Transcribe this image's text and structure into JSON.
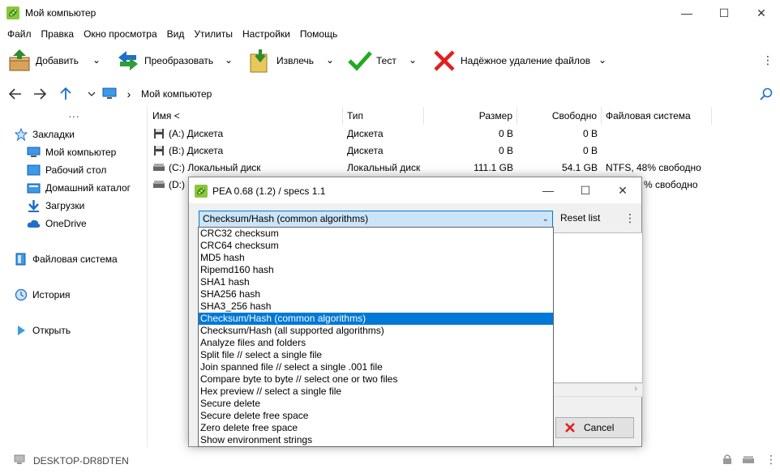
{
  "window": {
    "title": "Мой компьютер",
    "controls": {
      "minimize": "—",
      "maximize": "☐",
      "close": "✕"
    }
  },
  "menu": [
    "Файл",
    "Правка",
    "Окно просмотра",
    "Вид",
    "Утилиты",
    "Настройки",
    "Помощь"
  ],
  "toolbar": {
    "add": "Добавить",
    "convert": "Преобразовать",
    "extract": "Извлечь",
    "test": "Тест",
    "secure_delete": "Надёжное удаление файлов",
    "more": "⋮",
    "caret": "⌄"
  },
  "address": {
    "path": "Мой компьютер",
    "separator": "›"
  },
  "sidebar": {
    "dots": "···",
    "items": [
      {
        "label": "Закладки"
      },
      {
        "label": "Мой компьютер"
      },
      {
        "label": "Рабочий стол"
      },
      {
        "label": "Домашний каталог"
      },
      {
        "label": "Загрузки"
      },
      {
        "label": "OneDrive"
      },
      {
        "label": "Файловая система"
      },
      {
        "label": "История"
      },
      {
        "label": "Открыть"
      }
    ]
  },
  "list": {
    "columns": [
      "Имя <",
      "Тип",
      "Размер",
      "Свободно",
      "Файловая система"
    ],
    "rows": [
      {
        "name": "(A:) Дискета",
        "type": "Дискета",
        "size": "0 B",
        "free": "0 B",
        "fs": ""
      },
      {
        "name": "(B:) Дискета",
        "type": "Дискета",
        "size": "0 B",
        "free": "0 B",
        "fs": ""
      },
      {
        "name": "(C:) Локальный диск",
        "type": "Локальный диск",
        "size": "111.1 GB",
        "free": "54.1 GB",
        "fs": "NTFS, 48% свободно"
      },
      {
        "name": "(D:)",
        "type": "",
        "size": "",
        "free": "",
        "fs": "% свободно"
      }
    ]
  },
  "status": {
    "computer": "DESKTOP-DR8DTEN",
    "more": "⋮"
  },
  "dialog": {
    "title": "PEA 0.68 (1.2) / specs 1.1",
    "combo_value": "Checksum/Hash (common algorithms)",
    "combo_arrow": "⌄",
    "reset": "Reset list",
    "more": "⋮",
    "cancel": "Cancel",
    "scroll_left": "‹",
    "scroll_right": "›"
  },
  "dropdown": {
    "selected_index": 7,
    "options": [
      "CRC32 checksum",
      "CRC64 checksum",
      "MD5 hash",
      "Ripemd160 hash",
      "SHA1 hash",
      "SHA256 hash",
      "SHA3_256 hash",
      "Checksum/Hash (common algorithms)",
      "Checksum/Hash (all supported algorithms)",
      "Analyze files and folders",
      "Split file // select a single file",
      "Join spanned file // select a single .001 file",
      "Compare byte to byte // select one or two files",
      "Hex preview // select a single file",
      "Secure delete",
      "Secure delete free space",
      "Zero delete free space",
      "Show environment strings"
    ]
  },
  "colors": {
    "accent": "#0078d7",
    "selection": "#cce4f7",
    "delete_red": "#e02020",
    "test_green": "#22aa22"
  }
}
